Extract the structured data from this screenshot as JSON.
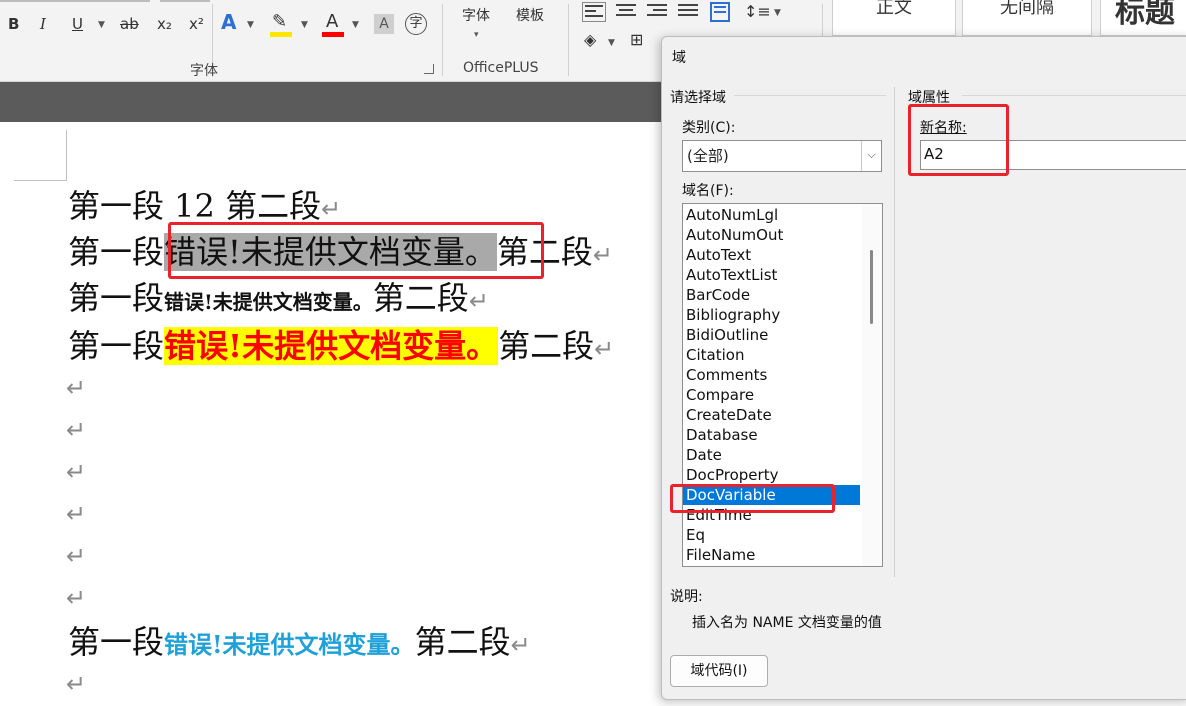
{
  "ribbon": {
    "font_buttons": {
      "bold": "B",
      "italic": "I",
      "underline": "U",
      "strikethrough": "ab",
      "subscript": "x₂",
      "superscript": "x²",
      "text_effects": "A",
      "font_color": "A",
      "char_shading": "A",
      "enclose_char": "字"
    },
    "font_group_label": "字体",
    "officeplus": {
      "font_btn": "字体",
      "template_btn": "模板",
      "group_label": "OfficePLUS"
    },
    "styles": [
      "正文",
      "无间隔",
      "标题"
    ],
    "colors": {
      "highlight_bar": "#ffe600",
      "font_color_bar": "#ff0000"
    }
  },
  "document": {
    "lines": [
      {
        "a": "第一段 12 第二段"
      },
      {
        "a": "第一段",
        "field": "错误!未提供文档变量。",
        "b": "第二段"
      },
      {
        "a": "第一段",
        "field": "错误!未提供文档变量。",
        "b": "第二段"
      },
      {
        "a": "第一段",
        "field": "错误!未提供文档变量。",
        "b": "第二段"
      },
      {
        "a": "第一段",
        "field": "错误!未提供文档变量。",
        "b": "第二段"
      }
    ],
    "return_mark": "↵",
    "colors": {
      "field_shading": "#a9a9a9",
      "red_text": "#ff0000",
      "yellow_highlight": "#ffff00",
      "blue_text": "#1fa1d8",
      "annotation_box": "#e8232b"
    }
  },
  "dialog": {
    "title": "域",
    "choose_field_label": "请选择域",
    "category_label": "类别(C):",
    "category_value": "(全部)",
    "field_names_label": "域名(F):",
    "field_names": [
      "AutoNumLgl",
      "AutoNumOut",
      "AutoText",
      "AutoTextList",
      "BarCode",
      "Bibliography",
      "BidiOutline",
      "Citation",
      "Comments",
      "Compare",
      "CreateDate",
      "Database",
      "Date",
      "DocProperty",
      "DocVariable",
      "EditTime",
      "Eq",
      "FileName"
    ],
    "selected_field": "DocVariable",
    "field_props_label": "域属性",
    "new_name_label": "新名称:",
    "new_name_value": "A2",
    "description_label": "说明:",
    "description_text": "插入名为 NAME 文档变量的值",
    "field_codes_button": "域代码(I)"
  }
}
